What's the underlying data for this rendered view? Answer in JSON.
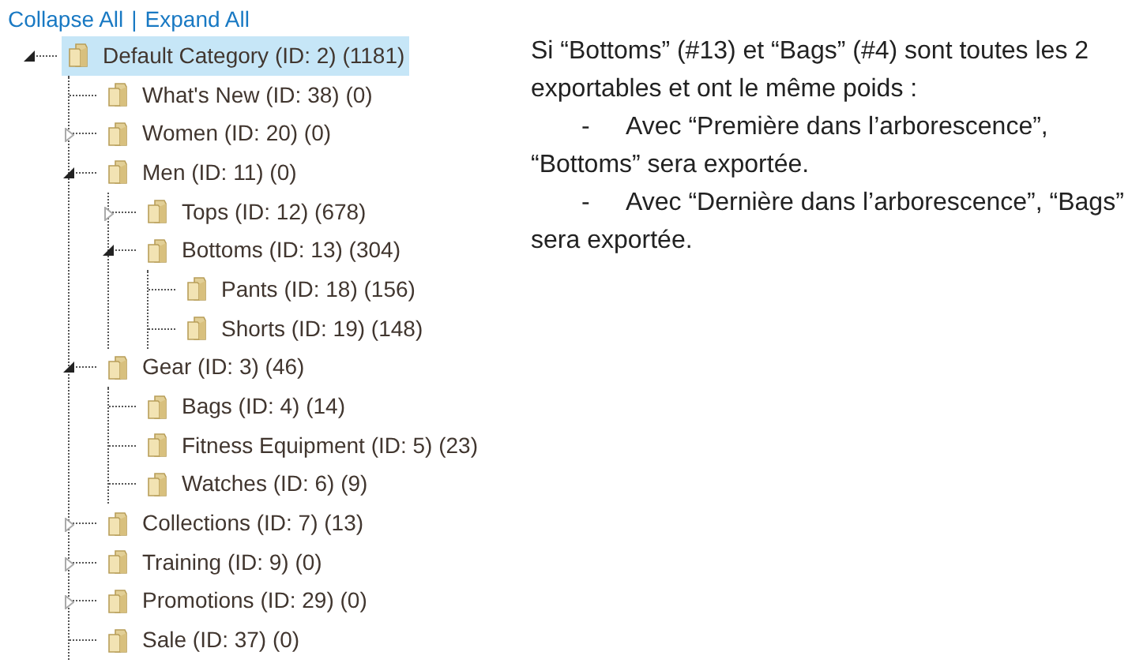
{
  "tree_actions": [
    {
      "label": "Collapse All"
    },
    {
      "label": "Expand All"
    }
  ],
  "separator": "|",
  "tree": [
    {
      "label": "Default Category (ID: 2) (1181)",
      "selected": true,
      "expanded": true,
      "children": [
        {
          "label": "What's New (ID: 38) (0)",
          "selected": false
        },
        {
          "label": "Women (ID: 20) (0)",
          "selected": false,
          "expanded": false
        },
        {
          "label": "Men (ID: 11) (0)",
          "selected": false,
          "expanded": true,
          "children": [
            {
              "label": "Tops (ID: 12) (678)",
              "selected": false,
              "expanded": false
            },
            {
              "label": "Bottoms (ID: 13) (304)",
              "selected": false,
              "expanded": true,
              "children": [
                {
                  "label": "Pants (ID: 18) (156)",
                  "selected": false
                },
                {
                  "label": "Shorts (ID: 19) (148)",
                  "selected": false
                }
              ]
            }
          ]
        },
        {
          "label": "Gear (ID: 3) (46)",
          "selected": false,
          "expanded": true,
          "children": [
            {
              "label": "Bags (ID: 4) (14)",
              "selected": false
            },
            {
              "label": "Fitness Equipment (ID: 5) (23)",
              "selected": false
            },
            {
              "label": "Watches (ID: 6) (9)",
              "selected": false
            }
          ]
        },
        {
          "label": "Collections (ID: 7) (13)",
          "selected": false,
          "expanded": false
        },
        {
          "label": "Training (ID: 9) (0)",
          "selected": false,
          "expanded": false
        },
        {
          "label": "Promotions (ID: 29) (0)",
          "selected": false,
          "expanded": false
        },
        {
          "label": "Sale (ID: 37) (0)",
          "selected": false
        }
      ]
    }
  ],
  "note": {
    "paragraph": "Si “Bottoms” (#13) et “Bags” (#4) sont toutes les 2 exportables et ont le même poids :",
    "items": [
      {
        "bullet": "-",
        "text": "Avec “Première dans l’arborescence”, “Bottoms” sera exportée."
      },
      {
        "bullet": "-",
        "text": "Avec “Dernière dans l’arborescence”, “Bags” sera exportée."
      }
    ]
  }
}
